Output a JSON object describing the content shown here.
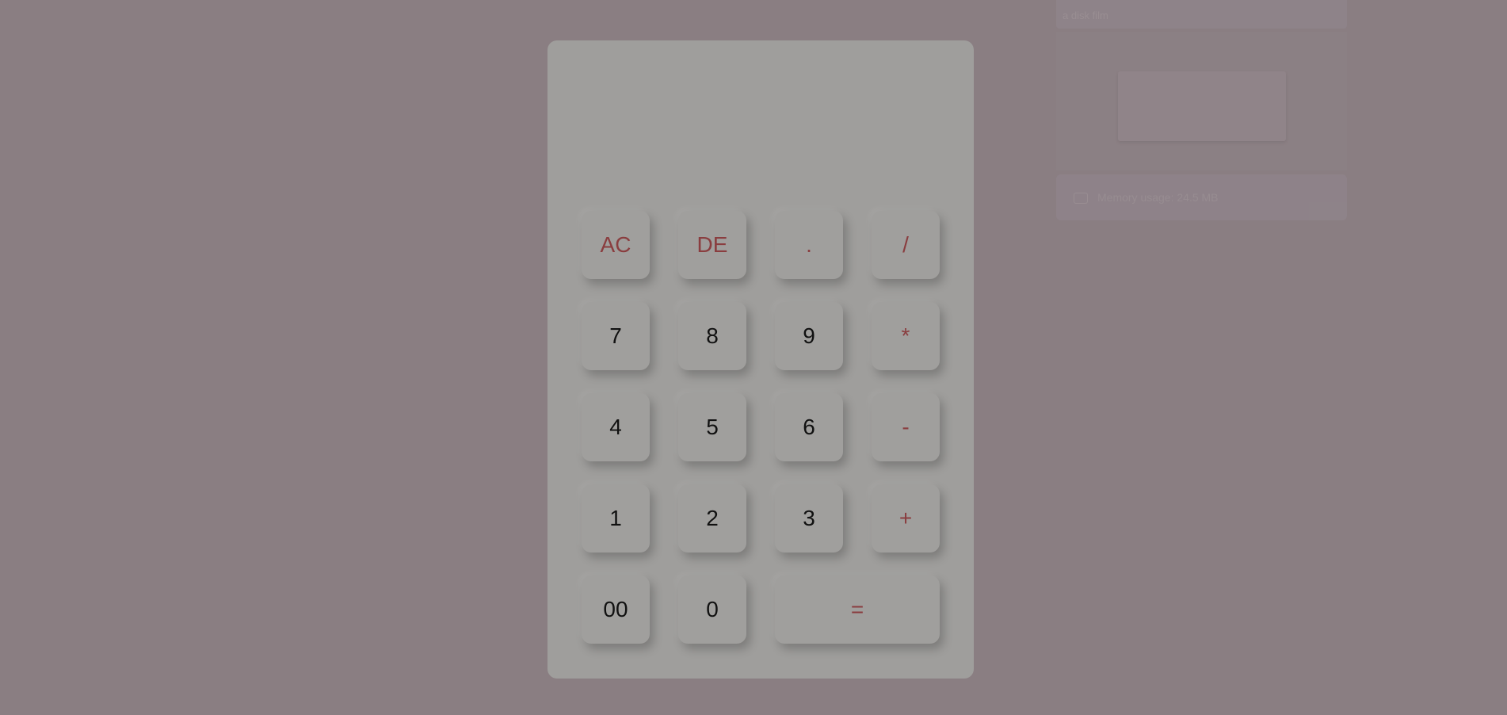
{
  "background_panel": {
    "header_text": "a disk film",
    "footer_text": "Memory usage: 24.5 MB"
  },
  "calculator": {
    "display_value": "",
    "accent_color": "#8a3d3f",
    "keys": [
      {
        "label": "AC",
        "type": "op"
      },
      {
        "label": "DE",
        "type": "op"
      },
      {
        "label": ".",
        "type": "op"
      },
      {
        "label": "/",
        "type": "op"
      },
      {
        "label": "7",
        "type": "num"
      },
      {
        "label": "8",
        "type": "num"
      },
      {
        "label": "9",
        "type": "num"
      },
      {
        "label": "*",
        "type": "op"
      },
      {
        "label": "4",
        "type": "num"
      },
      {
        "label": "5",
        "type": "num"
      },
      {
        "label": "6",
        "type": "num"
      },
      {
        "label": "-",
        "type": "op"
      },
      {
        "label": "1",
        "type": "num"
      },
      {
        "label": "2",
        "type": "num"
      },
      {
        "label": "3",
        "type": "num"
      },
      {
        "label": "+",
        "type": "op"
      },
      {
        "label": "00",
        "type": "num"
      },
      {
        "label": "0",
        "type": "num"
      },
      {
        "label": "=",
        "type": "op"
      }
    ]
  }
}
